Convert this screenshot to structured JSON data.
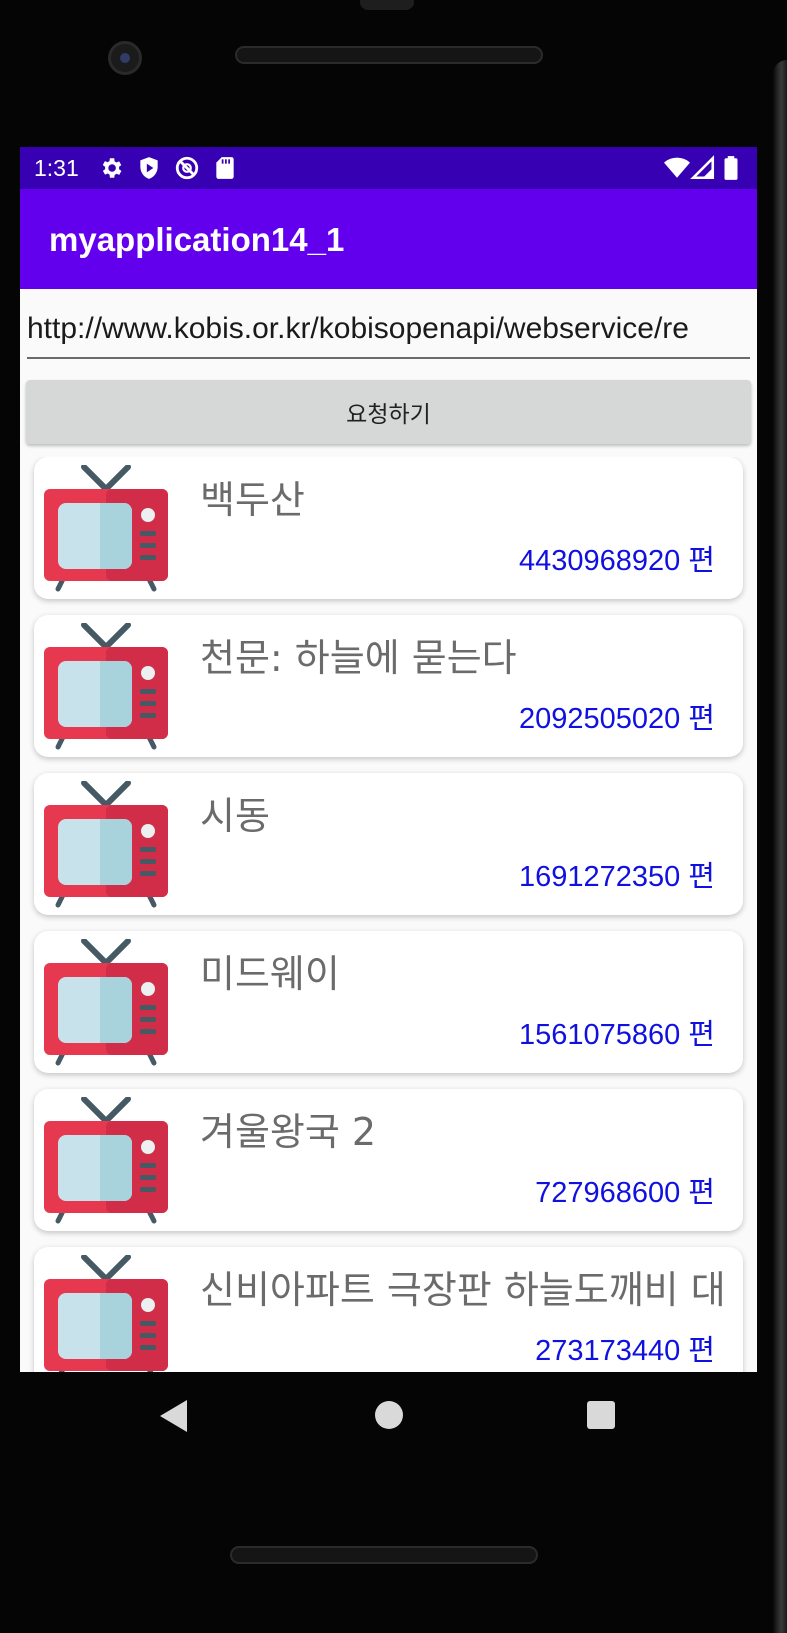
{
  "status_bar": {
    "time": "1:31",
    "left_icons": [
      "gear-icon",
      "shield-play-icon",
      "do-not-disturb-icon",
      "sd-card-icon"
    ],
    "right_icons": [
      "wifi-icon",
      "signal-icon",
      "battery-icon"
    ]
  },
  "app_bar": {
    "title": "myapplication14_1"
  },
  "url_field": {
    "value": "http://www.kobis.or.kr/kobisopenapi/webservice/re"
  },
  "request_button": {
    "label": "요청하기"
  },
  "movies": [
    {
      "title": "백두산",
      "count": "4430968920 편"
    },
    {
      "title": "천문: 하늘에 묻는다",
      "count": "2092505020 편"
    },
    {
      "title": "시동",
      "count": "1691272350 편"
    },
    {
      "title": "미드웨이",
      "count": "1561075860 편"
    },
    {
      "title": "겨울왕국 2",
      "count": "727968600 편"
    },
    {
      "title": "신비아파트 극장판 하늘도깨비 대",
      "count": "273173440 편"
    }
  ],
  "colors": {
    "status_bar": "#3700b3",
    "app_bar": "#6200ee",
    "count_text": "#1010e0",
    "title_text": "#6b6b6b"
  }
}
